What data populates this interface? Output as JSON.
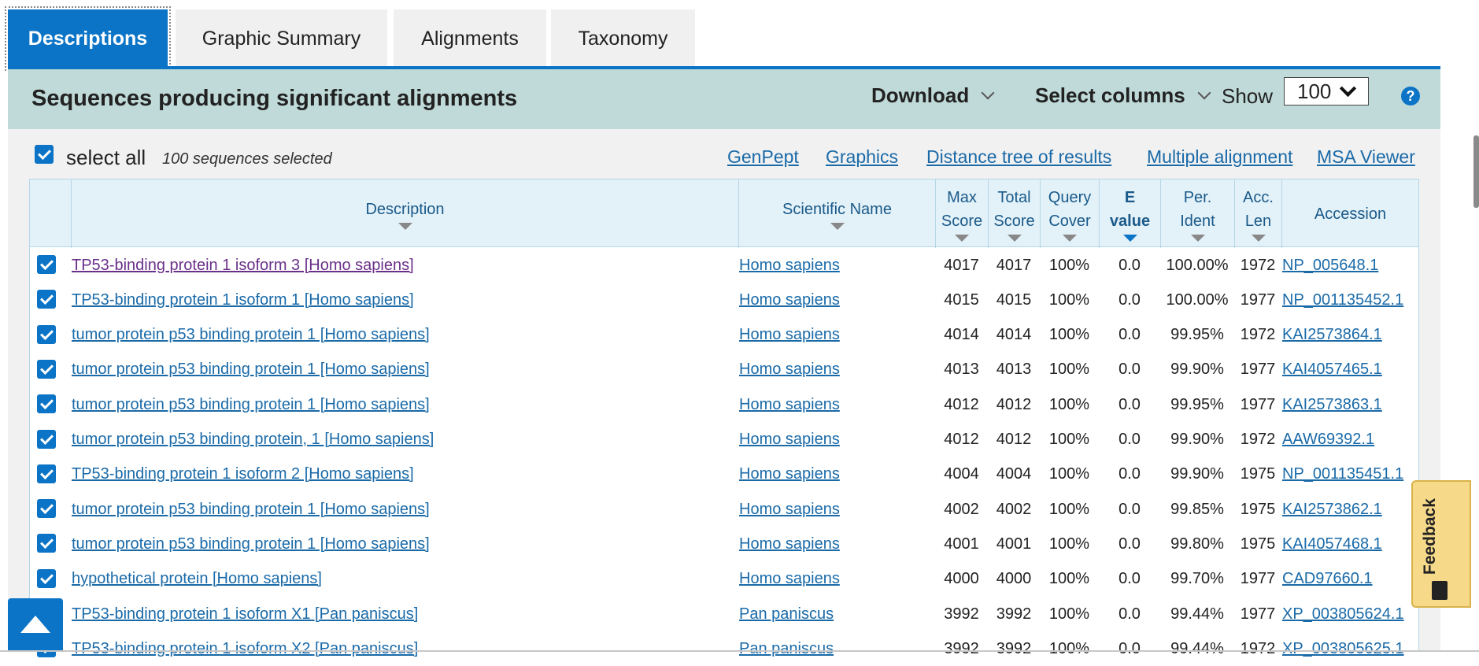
{
  "tabs": [
    {
      "label": "Descriptions",
      "active": true
    },
    {
      "label": "Graphic Summary",
      "active": false
    },
    {
      "label": "Alignments",
      "active": false
    },
    {
      "label": "Taxonomy",
      "active": false
    }
  ],
  "header": {
    "title": "Sequences producing significant alignments",
    "download_label": "Download",
    "select_columns_label": "Select columns",
    "show_label": "Show",
    "show_value": "100",
    "help_symbol": "?"
  },
  "selection": {
    "select_all_label": "select all",
    "selected_count": "100 sequences selected"
  },
  "links": {
    "genpept": "GenPept",
    "graphics": "Graphics",
    "distance_tree": "Distance tree of results",
    "multiple_alignment": "Multiple alignment",
    "msa_viewer": "MSA Viewer"
  },
  "columns": {
    "description": "Description",
    "scientific_name": "Scientific Name",
    "max_score_1": "Max",
    "max_score_2": "Score",
    "total_score_1": "Total",
    "total_score_2": "Score",
    "query_cover_1": "Query",
    "query_cover_2": "Cover",
    "evalue_1": "E",
    "evalue_2": "value",
    "per_ident_1": "Per.",
    "per_ident_2": "Ident",
    "acc_len_1": "Acc.",
    "acc_len_2": "Len",
    "accession": "Accession"
  },
  "rows": [
    {
      "description": "TP53-binding protein 1 isoform 3 [Homo sapiens]",
      "sci": "Homo sapiens",
      "max": "4017",
      "total": "4017",
      "cover": "100%",
      "evalue": "0.0",
      "ident": "100.00%",
      "len": "1972",
      "acc": "NP_005648.1"
    },
    {
      "description": "TP53-binding protein 1 isoform 1 [Homo sapiens]",
      "sci": "Homo sapiens",
      "max": "4015",
      "total": "4015",
      "cover": "100%",
      "evalue": "0.0",
      "ident": "100.00%",
      "len": "1977",
      "acc": "NP_001135452.1"
    },
    {
      "description": "tumor protein p53 binding protein 1 [Homo sapiens]",
      "sci": "Homo sapiens",
      "max": "4014",
      "total": "4014",
      "cover": "100%",
      "evalue": "0.0",
      "ident": "99.95%",
      "len": "1972",
      "acc": "KAI2573864.1"
    },
    {
      "description": "tumor protein p53 binding protein 1 [Homo sapiens]",
      "sci": "Homo sapiens",
      "max": "4013",
      "total": "4013",
      "cover": "100%",
      "evalue": "0.0",
      "ident": "99.90%",
      "len": "1977",
      "acc": "KAI4057465.1"
    },
    {
      "description": "tumor protein p53 binding protein 1 [Homo sapiens]",
      "sci": "Homo sapiens",
      "max": "4012",
      "total": "4012",
      "cover": "100%",
      "evalue": "0.0",
      "ident": "99.95%",
      "len": "1977",
      "acc": "KAI2573863.1"
    },
    {
      "description": "tumor protein p53 binding protein, 1 [Homo sapiens]",
      "sci": "Homo sapiens",
      "max": "4012",
      "total": "4012",
      "cover": "100%",
      "evalue": "0.0",
      "ident": "99.90%",
      "len": "1972",
      "acc": "AAW69392.1"
    },
    {
      "description": "TP53-binding protein 1 isoform 2 [Homo sapiens]",
      "sci": "Homo sapiens",
      "max": "4004",
      "total": "4004",
      "cover": "100%",
      "evalue": "0.0",
      "ident": "99.90%",
      "len": "1975",
      "acc": "NP_001135451.1"
    },
    {
      "description": "tumor protein p53 binding protein 1 [Homo sapiens]",
      "sci": "Homo sapiens",
      "max": "4002",
      "total": "4002",
      "cover": "100%",
      "evalue": "0.0",
      "ident": "99.85%",
      "len": "1975",
      "acc": "KAI2573862.1"
    },
    {
      "description": "tumor protein p53 binding protein 1 [Homo sapiens]",
      "sci": "Homo sapiens",
      "max": "4001",
      "total": "4001",
      "cover": "100%",
      "evalue": "0.0",
      "ident": "99.80%",
      "len": "1975",
      "acc": "KAI4057468.1"
    },
    {
      "description": "hypothetical protein [Homo sapiens]",
      "sci": "Homo sapiens",
      "max": "4000",
      "total": "4000",
      "cover": "100%",
      "evalue": "0.0",
      "ident": "99.70%",
      "len": "1977",
      "acc": "CAD97660.1"
    },
    {
      "description": "TP53-binding protein 1 isoform X1 [Pan paniscus]",
      "sci": "Pan paniscus",
      "max": "3992",
      "total": "3992",
      "cover": "100%",
      "evalue": "0.0",
      "ident": "99.44%",
      "len": "1977",
      "acc": "XP_003805624.1"
    },
    {
      "description": "TP53-binding protein 1 isoform X2 [Pan paniscus]",
      "sci": "Pan paniscus",
      "max": "3992",
      "total": "3992",
      "cover": "100%",
      "evalue": "0.0",
      "ident": "99.44%",
      "len": "1972",
      "acc": "XP_003805625.1"
    }
  ],
  "feedback_label": "Feedback",
  "colors": {
    "accent": "#0b74c6",
    "header_band": "#bfdad8",
    "link": "#1a6aa8",
    "visited_link": "#6a2f8a"
  }
}
